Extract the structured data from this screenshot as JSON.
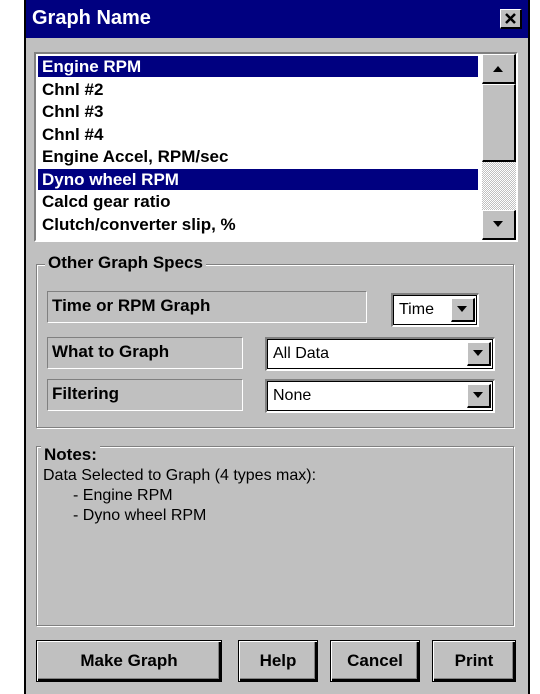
{
  "window": {
    "title": "Graph Name"
  },
  "graph_list": {
    "items": [
      {
        "label": "Engine RPM",
        "selected": true
      },
      {
        "label": "Chnl #2",
        "selected": false
      },
      {
        "label": "Chnl #3",
        "selected": false
      },
      {
        "label": "Chnl #4",
        "selected": false
      },
      {
        "label": "Engine Accel, RPM/sec",
        "selected": false
      },
      {
        "label": "Dyno wheel RPM",
        "selected": true
      },
      {
        "label": "Calcd gear ratio",
        "selected": false
      },
      {
        "label": "Clutch/converter slip, %",
        "selected": false
      }
    ]
  },
  "other_specs": {
    "legend": "Other Graph Specs",
    "time_or_rpm": {
      "label": "Time or RPM Graph",
      "value": "Time"
    },
    "what_to_graph": {
      "label": "What to Graph",
      "value": "All Data"
    },
    "filtering": {
      "label": "Filtering",
      "value": "None"
    }
  },
  "notes": {
    "legend": "Notes:",
    "line1": "Data Selected to Graph (4 types max):",
    "line2": "- Engine RPM",
    "line3": "- Dyno wheel RPM"
  },
  "buttons": {
    "make_graph": "Make Graph",
    "help": "Help",
    "cancel": "Cancel",
    "print": "Print"
  },
  "colors": {
    "selection": "#000080",
    "face": "#c0c0c0"
  }
}
